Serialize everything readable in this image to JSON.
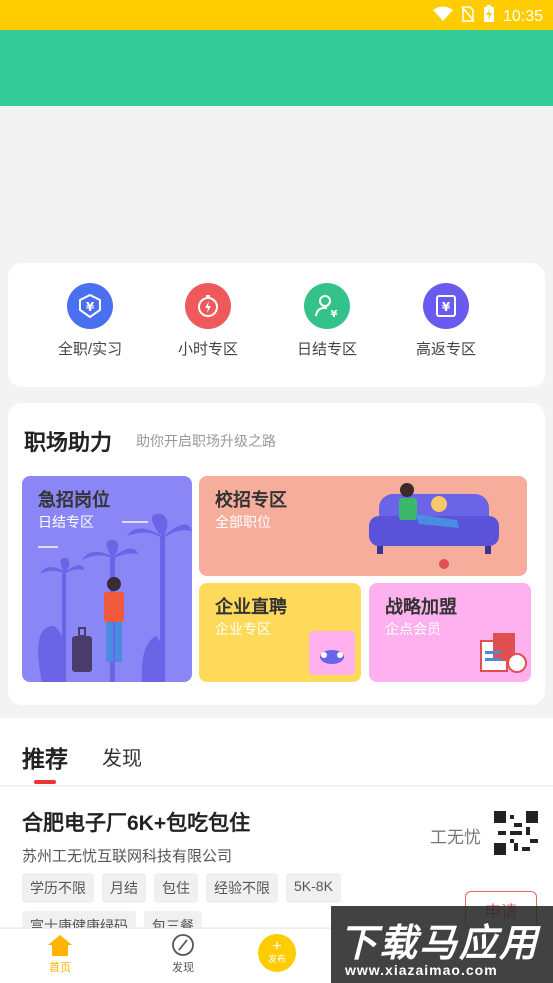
{
  "status_bar": {
    "time": "10:35",
    "icons": [
      "wifi-icon",
      "no-sim-icon",
      "battery-charging-icon"
    ]
  },
  "categories": [
    {
      "label": "全职/实习",
      "icon": "yen-shield-icon",
      "color": "#4a6ff0"
    },
    {
      "label": "小时专区",
      "icon": "stopwatch-icon",
      "color": "#ee5a5a"
    },
    {
      "label": "日结专区",
      "icon": "person-yen-icon",
      "color": "#35c28a"
    },
    {
      "label": "高返专区",
      "icon": "yen-card-icon",
      "color": "#6a5af0"
    }
  ],
  "career_help": {
    "title": "职场助力",
    "subtitle": "助你开启职场升级之路",
    "tiles": [
      {
        "title": "急招岗位",
        "sub": "日结专区"
      },
      {
        "title": "校招专区",
        "sub": "全部职位"
      },
      {
        "title": "企业直聘",
        "sub": "企业专区"
      },
      {
        "title": "战略加盟",
        "sub": "企点会员"
      }
    ]
  },
  "feed_tabs": {
    "active": "推荐",
    "other": "发现"
  },
  "job": {
    "title": "合肥电子厂6K+包吃包住",
    "company": "苏州工无忧互联网科技有限公司",
    "tags": [
      "学历不限",
      "月结",
      "包住",
      "经验不限",
      "5K-8K",
      "富士康健康绿码",
      "包三餐"
    ],
    "brand": "工无忧",
    "apply_label": "申请"
  },
  "bottom_nav": {
    "home": "首页",
    "discover": "发现",
    "publish": "发布"
  },
  "watermark": {
    "main": "下载马应用",
    "url": "www.xiazaimao.com"
  }
}
